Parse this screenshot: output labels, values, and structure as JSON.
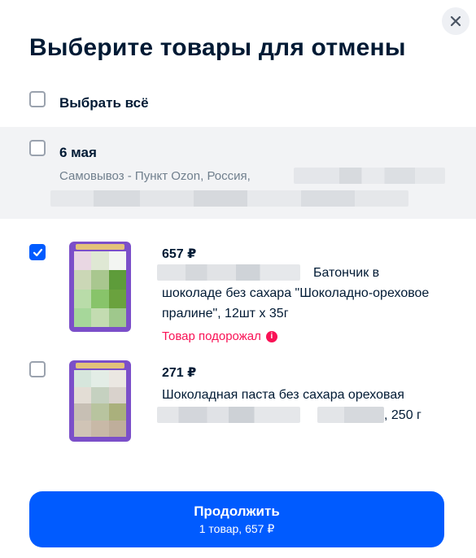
{
  "modal": {
    "title": "Выберите товары для отмены",
    "close_icon": "close-icon"
  },
  "select_all": {
    "label": "Выбрать всё",
    "checked": false
  },
  "shipment": {
    "date": "6 мая",
    "address": "Самовывоз - Пункт Ozon, Россия,",
    "checked": false
  },
  "items": [
    {
      "checked": true,
      "price": "657 ₽",
      "title_line1": "Батончик в",
      "title_rest": "шоколаде без сахара \"Шоколадно-ореховое пралине\", 12шт х 35г",
      "price_notice": "Товар подорожал",
      "notice_icon": "info-icon"
    },
    {
      "checked": false,
      "price": "271 ₽",
      "title_line1": "Шоколадная паста без сахара ореховая",
      "title_tail": ", 250 г"
    }
  ],
  "continue_button": {
    "label": "Продолжить",
    "summary": "1 товар, 657 ₽"
  },
  "colors": {
    "accent": "#005bff",
    "alert": "#f91155",
    "text": "#001a34",
    "muted": "#707f8d"
  }
}
